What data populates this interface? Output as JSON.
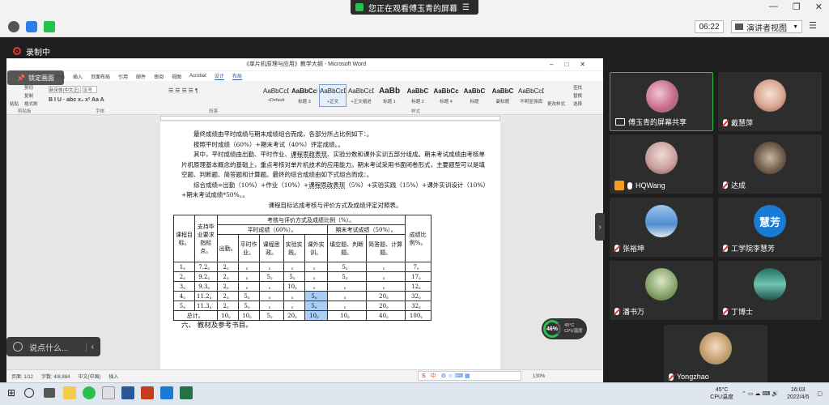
{
  "top_bar": {
    "share_banner": "您正在观看傅玉青的屏幕",
    "timer": "06:22",
    "view_mode": "演讲者视图",
    "recording": "录制中"
  },
  "word": {
    "title": "《单片机原理与应用》教学大纲 - Microsoft Word",
    "lock_label": "锁定画面",
    "tabs": [
      "开始",
      "插入",
      "页面布局",
      "引用",
      "邮件",
      "审阅",
      "视图",
      "Acrobat",
      "设计",
      "布局"
    ],
    "ribbon": {
      "paste": "粘贴",
      "cut": "剪切",
      "copy": "复制",
      "format_painter": "格式刷",
      "font_name": "新宋体(中文正)",
      "font_size": "五号",
      "clipboard_group": "剪贴板",
      "font_group": "字体",
      "paragraph_group": "段落",
      "styles_group": "样式",
      "styles": [
        {
          "preview": "AaBbCcDc",
          "name": "+Default"
        },
        {
          "preview": "AaBbCcI",
          "name": "标题 3"
        },
        {
          "preview": "AaBbCcDd",
          "name": "+正文"
        },
        {
          "preview": "AaBbCcD",
          "name": "+正文缩进"
        },
        {
          "preview": "AaBb",
          "name": "标题 1"
        },
        {
          "preview": "AaBbC",
          "name": "标题 2"
        },
        {
          "preview": "AaBbCc",
          "name": "标题 4"
        },
        {
          "preview": "AaBbC",
          "name": "标题"
        },
        {
          "preview": "AaBbC",
          "name": "副标题"
        },
        {
          "preview": "AaBbCcDc",
          "name": "不明显强调"
        }
      ],
      "change_styles": "更改样式",
      "find": "查找",
      "replace": "替换",
      "select": "选择"
    },
    "doc": {
      "p1": "最终成绩由平时成绩与期末成绩组合而成，各部分所占比例如下：。",
      "p2": "按照平时成绩（60%）+期末考试（40%）评定成绩。。",
      "p3a": "其中，平时成绩由出勤、平时作业、",
      "p3u": "课程思政表现",
      "p3b": "、实验分数和课外实训五部分组成。期末考试成绩由考核单片机原理基本概念的基础上，重点考核对单片机技术的应用能力。期末考试采用书面闭卷形式，主要题型可以是填空题、判断题、简答题和计算题。最终的综合成绩由如下式组合而成：。",
      "p4a": "综合成绩=出勤（10%）+作业（10%）+",
      "p4u": "课程思政表现",
      "p4b": "（5%）+实验实践（15%）+课外实训设计（10%）+期末考试成绩*50%。。",
      "table_title": "课程目标达成考核与评价方式及成绩评定对照表。",
      "table": {
        "h_goal": "课程目标。",
        "h_support": "支持毕业要求指标点。",
        "h_assess": "考核与评价方式及成绩比例（%）。",
        "h_final_ratio": "成绩比例%。",
        "h_usual": "平时成绩（60%）。",
        "h_exam": "期末考试成绩（50%）。",
        "sub": [
          "出勤。",
          "平时作业。",
          "课程思政。",
          "实验实践。",
          "课外实训。",
          "填空题、判断题。",
          "简答题、计算题。"
        ],
        "rows": [
          [
            "1。",
            "7.2。",
            "2。",
            "。",
            "。",
            "。",
            "。",
            "5。",
            "。",
            "7。"
          ],
          [
            "2。",
            "9.2。",
            "2。",
            "。",
            "5。",
            "5。",
            "。",
            "5。",
            "。",
            "17。"
          ],
          [
            "3。",
            "9.3。",
            "2。",
            "。",
            "。",
            "10。",
            "。",
            "。",
            "。",
            "12。"
          ],
          [
            "4。",
            "11.2。",
            "2。",
            "5。",
            "。",
            "。",
            "5。",
            "。",
            "20。",
            "32。"
          ],
          [
            "5。",
            "11.3。",
            "2。",
            "5。",
            "。",
            "。",
            "5。",
            "。",
            "20。",
            "32。"
          ]
        ],
        "total": [
          "总计。",
          "10。",
          "10。",
          "5。",
          "20。",
          "10。",
          "10。",
          "40。",
          "100。"
        ]
      },
      "section6": "六、    教材及参考书目。"
    },
    "status": {
      "page": "页面: 1/12",
      "words": "字数: 4/8,884",
      "lang": "中文(中国)",
      "mode": "插入",
      "zoom": "130%"
    },
    "ime": "中"
  },
  "chat_placeholder": "说点什么...",
  "cpu": {
    "percent": "46%",
    "temp": "45°C",
    "label": "CPU温度"
  },
  "participants": [
    {
      "name": "傅玉青的屏幕共享",
      "color": "#d98aa0"
    },
    {
      "name": "戴慧萍",
      "color": "#f0d8c8"
    },
    {
      "name": "HQWang",
      "color": "#e8c8c0"
    },
    {
      "name": "达成",
      "color": "#8a7a6a"
    },
    {
      "name": "张裕坤",
      "color": "#6fa3d8"
    },
    {
      "name": "工学院李慧芳",
      "avatar_text": "慧芳",
      "color": "#1a7bd6"
    },
    {
      "name": "潘书万",
      "color": "#8aa870"
    },
    {
      "name": "丁博士",
      "color": "#2f8a7a"
    },
    {
      "name": "Yongzhao",
      "color": "#c8a070"
    }
  ],
  "taskbar": {
    "temp": "45°C",
    "cpu_label": "CPU温度",
    "time": "16:03",
    "date": "2022/4/5"
  }
}
